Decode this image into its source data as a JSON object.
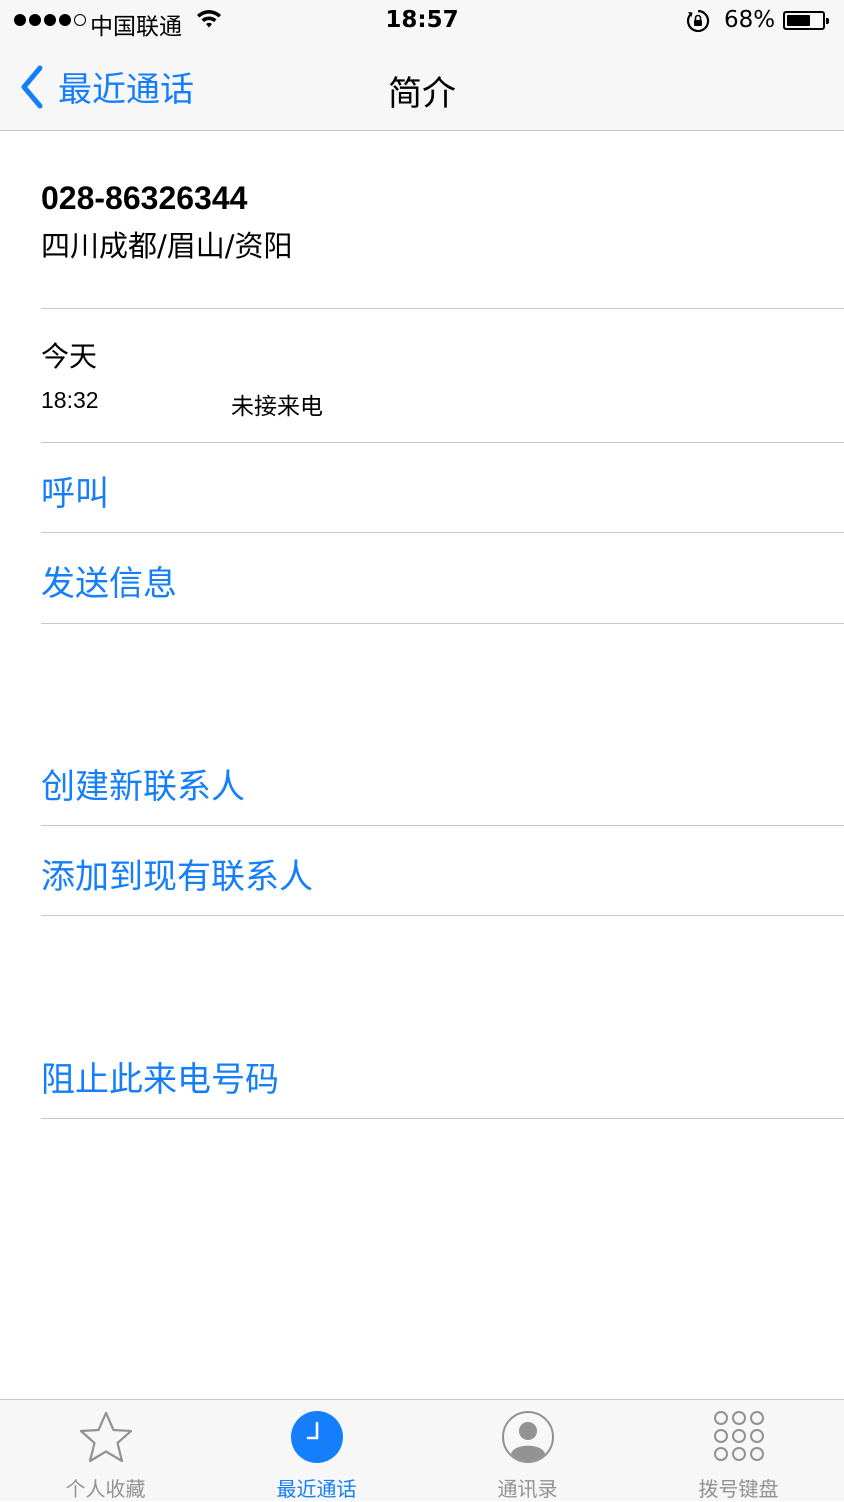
{
  "status_bar": {
    "carrier": "中国联通",
    "time": "18:57",
    "battery_percent": "68%",
    "battery_level": 0.68,
    "signal_strength": 4,
    "signal_max": 5
  },
  "nav": {
    "back_label": "最近通话",
    "title": "简介"
  },
  "caller": {
    "number": "028-86326344",
    "location": "四川成都/眉山/资阳"
  },
  "call_history": {
    "day": "今天",
    "entries": [
      {
        "time": "18:32",
        "status": "未接来电"
      }
    ]
  },
  "actions": {
    "call": "呼叫",
    "send_message": "发送信息",
    "create_contact": "创建新联系人",
    "add_to_existing": "添加到现有联系人",
    "block": "阻止此来电号码"
  },
  "tab_bar": {
    "active": "recents",
    "tabs": [
      {
        "id": "favorites",
        "label": "个人收藏",
        "icon": "star-icon"
      },
      {
        "id": "recents",
        "label": "最近通话",
        "icon": "clock-icon"
      },
      {
        "id": "contacts",
        "label": "通讯录",
        "icon": "contact-icon"
      },
      {
        "id": "keypad",
        "label": "拨号键盘",
        "icon": "keypad-icon"
      }
    ]
  },
  "colors": {
    "accent": "#157efb",
    "separator": "#c8c7cc",
    "bar_background": "#f7f7f7",
    "inactive_tab": "#929292"
  }
}
